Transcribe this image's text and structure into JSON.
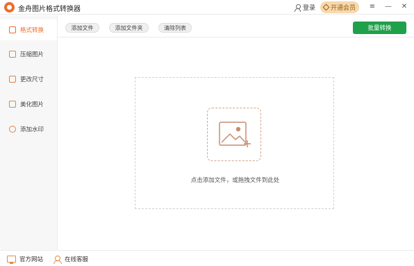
{
  "app": {
    "title": "金舟图片格式转换器"
  },
  "header": {
    "login_label": "登录",
    "vip_label": "开通会员"
  },
  "window_controls": {
    "menu": "≡",
    "minimize": "—",
    "close": "✕"
  },
  "sidebar": {
    "items": [
      {
        "label": "格式转换",
        "icon": "format-convert-icon",
        "active": true
      },
      {
        "label": "压缩图片",
        "icon": "compress-icon",
        "active": false
      },
      {
        "label": "更改尺寸",
        "icon": "resize-icon",
        "active": false
      },
      {
        "label": "美化图片",
        "icon": "beautify-icon",
        "active": false
      },
      {
        "label": "添加水印",
        "icon": "watermark-icon",
        "active": false
      }
    ]
  },
  "toolbar": {
    "add_file": "添加文件",
    "add_folder": "添加文件夹",
    "clear_list": "清除列表",
    "batch_convert": "批量转换"
  },
  "dropzone": {
    "hint": "点击添加文件，或拖拽文件到此处"
  },
  "footer": {
    "website": "官方网站",
    "support": "在线客服"
  },
  "colors": {
    "accent": "#ef6b2c",
    "primary_button": "#1fa04a",
    "vip_bg": "#f6d9ad"
  }
}
